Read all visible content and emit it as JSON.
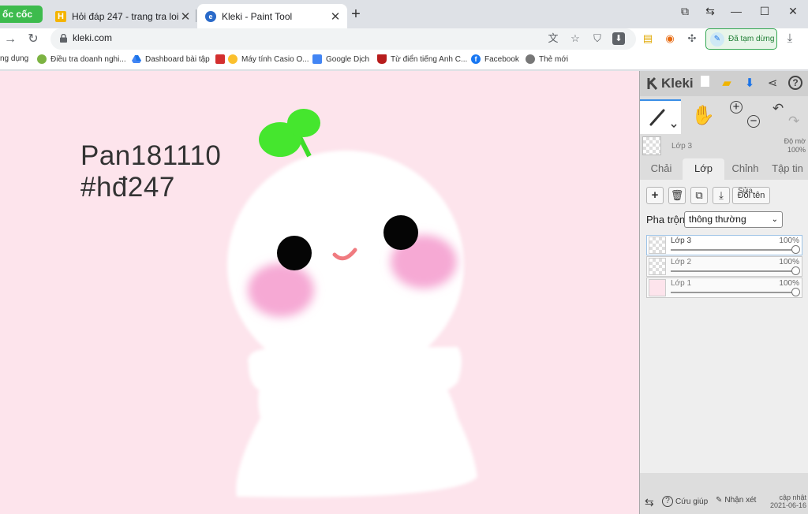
{
  "browser": {
    "logo": "ốc cốc",
    "tabs": [
      {
        "title": "Hỏi đáp 247 - trang tra loi",
        "icon": "h-icon"
      },
      {
        "title": "Kleki - Paint Tool",
        "icon": "kleki-icon"
      }
    ],
    "url": "kleki.com",
    "paused_label": "Đã tạm dừng"
  },
  "bookmarks": [
    {
      "label": "ng dụng",
      "icon": "apps-icon"
    },
    {
      "label": "Điều tra doanh nghi...",
      "icon": "survey-icon"
    },
    {
      "label": "Dashboard bài tập",
      "icon": "drive-icon"
    },
    {
      "label": "Máy tính Casio O...",
      "icon": "emoji-icon"
    },
    {
      "label": "Google Dịch",
      "icon": "translate-icon"
    },
    {
      "label": "Từ điển tiếng Anh C...",
      "icon": "dictionary-icon"
    },
    {
      "label": "Facebook",
      "icon": "facebook-icon"
    },
    {
      "label": "Thẻ mới",
      "icon": "globe-icon"
    }
  ],
  "canvas": {
    "line1": "Pan181110",
    "line2": "#hđ247",
    "background": "#fde4ec"
  },
  "kleki": {
    "brand": "Kleki",
    "preview_layer": "Lớp 3",
    "preview_opacity_label": "Độ mờ",
    "preview_opacity_value": "100%",
    "tabs": [
      "Chải",
      "Lớp",
      "Chỉnh",
      "Tập tin"
    ],
    "rename_sub": "Sửa",
    "rename_label": "Đổi tên",
    "blend_label": "Pha trộn",
    "blend_value": "thông thường",
    "layers": [
      {
        "name": "Lớp 3",
        "opacity": "100%"
      },
      {
        "name": "Lớp 2",
        "opacity": "100%"
      },
      {
        "name": "Lớp 1",
        "opacity": "100%"
      }
    ],
    "footer": {
      "help": "Cứu giúp",
      "feedback": "Nhận xét",
      "update_label": "cập nhật",
      "update_date": "2021-06-16"
    }
  }
}
